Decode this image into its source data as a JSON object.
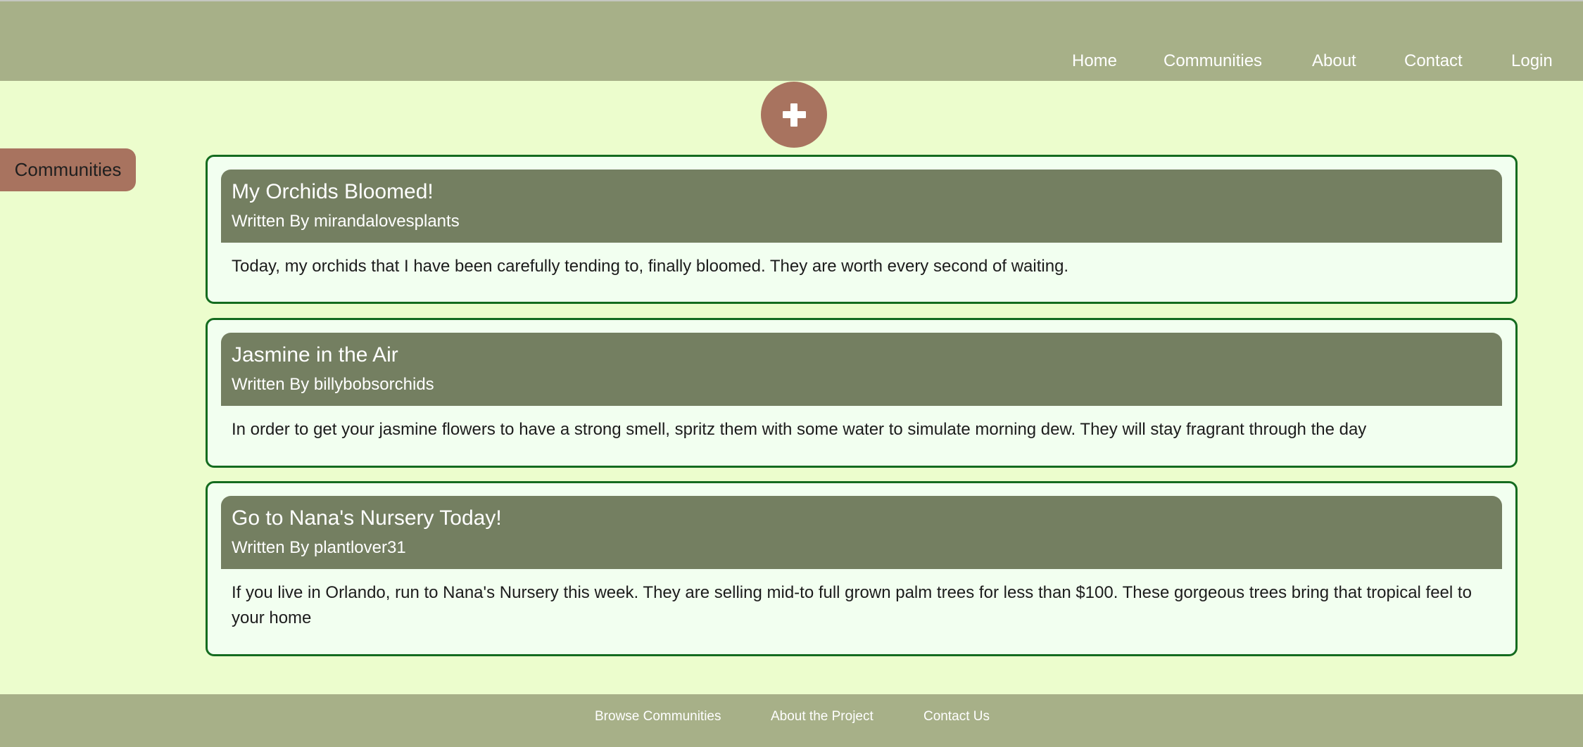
{
  "nav": {
    "items": [
      {
        "label": "Home"
      },
      {
        "label": "Communities"
      },
      {
        "label": "About"
      },
      {
        "label": "Contact"
      },
      {
        "label": "Login"
      }
    ]
  },
  "add_button": {
    "icon": "plus-icon",
    "color": "#a8735f"
  },
  "sidebar": {
    "communities_label": "Communities"
  },
  "posts": [
    {
      "title": "My Orchids Bloomed!",
      "author": "Written By mirandalovesplants",
      "body": "Today, my orchids that I have been carefully tending to, finally bloomed. They are worth every second of waiting."
    },
    {
      "title": "Jasmine in the Air",
      "author": "Written By billybobsorchids",
      "body": "In order to get your jasmine flowers to have a strong smell, spritz them with some water to simulate morning dew. They will stay fragrant through the day"
    },
    {
      "title": "Go to Nana's Nursery Today!",
      "author": "Written By plantlover31",
      "body": "If you live in Orlando, run to Nana's Nursery this week. They are selling mid-to full grown palm trees for less than $100. These gorgeous trees bring that tropical feel to your home"
    }
  ],
  "footer": {
    "links": [
      {
        "label": "Browse Communities"
      },
      {
        "label": "About the Project"
      },
      {
        "label": "Contact Us"
      }
    ]
  },
  "colors": {
    "page_bg": "#ecfdcd",
    "nav_bg": "#a7b088",
    "accent": "#a8735f",
    "card_border": "#146b1f",
    "card_header": "#747f61",
    "card_bg": "#f2fff0"
  }
}
